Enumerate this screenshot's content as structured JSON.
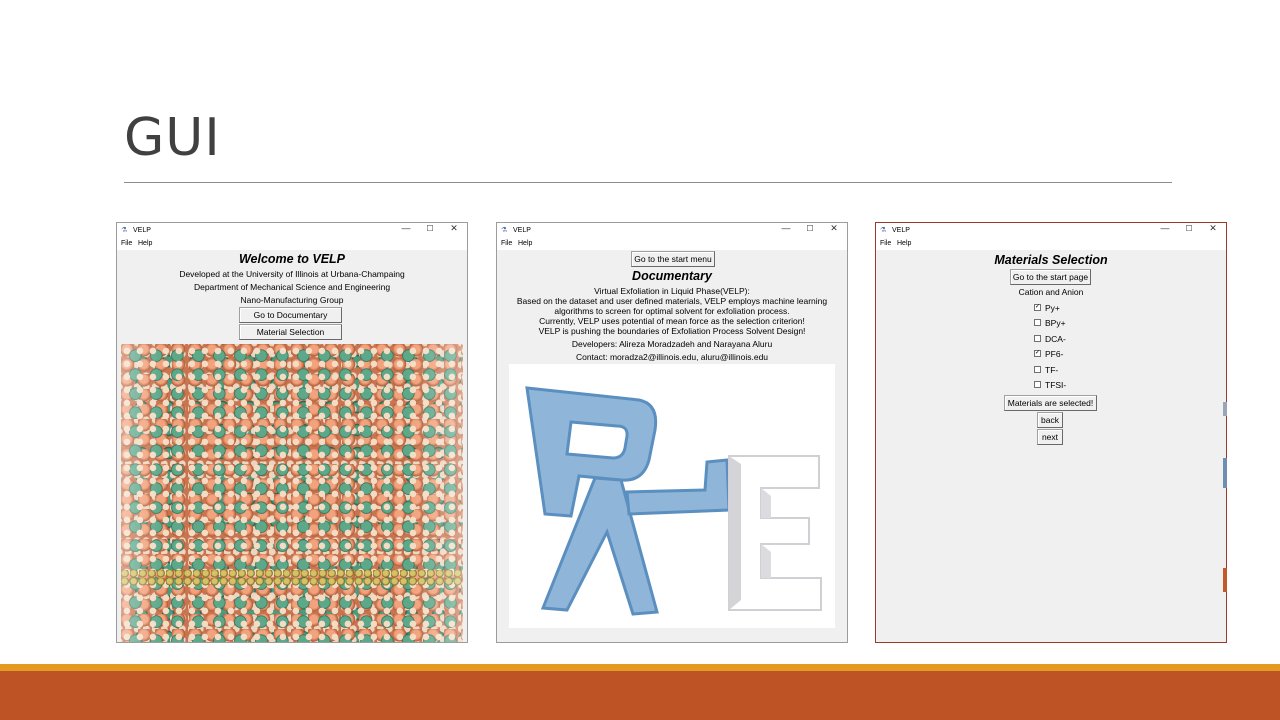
{
  "slide": {
    "title": "GUI",
    "colors": {
      "title": "#404040",
      "accent_thin": "#e49a23",
      "accent_band": "#be5426"
    }
  },
  "window_common": {
    "app_name": "VELP",
    "menu": [
      "File",
      "Help"
    ],
    "controls": {
      "minimize": "—",
      "maximize": "☐",
      "close": "✕"
    }
  },
  "welcome_window": {
    "heading": "Welcome to VELP",
    "lines": [
      "Developed at the University of Illinois at Urbana-Champaing",
      "Department of Mechanical Science and Engineering",
      "Nano-Manufacturing Group"
    ],
    "buttons": [
      "Go to Documentary",
      "Material Selection"
    ],
    "image": "molecular-simulation-image"
  },
  "documentary_window": {
    "top_button": "Go to the start menu",
    "heading": "Documentary",
    "lines": [
      "Virtual Exfoliation in Liquid Phase(VELP):",
      "Based on the dataset and user defined materials, VELP employs machine learning",
      "algorithms to screen for optimal solvent for exfoliation process.",
      "Currently, VELP uses potential of mean force as the selection criterion!",
      "VELP is pushing the boundaries of Exfoliation Process Solvent Design!"
    ],
    "developers": "Developers: Alireza Moradzadeh and Narayana Aluru",
    "contact": "Contact: moradza2@illinois.edu, aluru@illinois.edu",
    "image": "velp-logo-image"
  },
  "materials_window": {
    "heading": "Materials Selection",
    "start_button": "Go to the start page",
    "subheading": "Cation and Anion",
    "options": [
      {
        "label": "Py+",
        "checked": true
      },
      {
        "label": "BPy+",
        "checked": false
      },
      {
        "label": "DCA-",
        "checked": false
      },
      {
        "label": "PF6-",
        "checked": true
      },
      {
        "label": "TF-",
        "checked": false
      },
      {
        "label": "TFSI-",
        "checked": false
      }
    ],
    "check_mark": "✓",
    "buttons": [
      "Materials are selected!",
      "back",
      "next"
    ]
  }
}
